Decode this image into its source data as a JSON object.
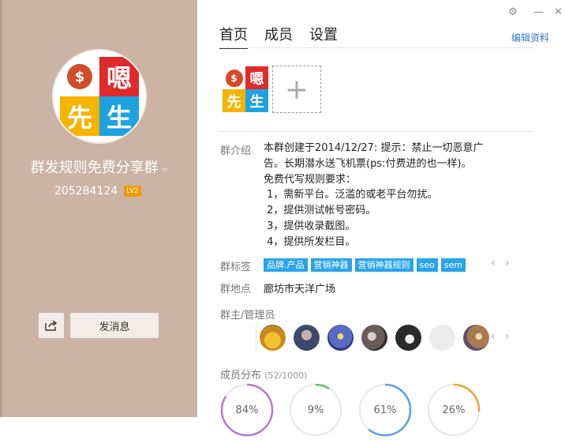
{
  "window": {
    "controls": {
      "pin": "⚙",
      "minimize": "—",
      "close": "✕"
    },
    "colors": {
      "sidebar": "#cbb3a6",
      "accent": "#2aa4e8",
      "link": "#2a7ac8",
      "level_badge": "#f39800"
    }
  },
  "logo": {
    "top_right": "嗯",
    "bottom_left": "先",
    "bottom_right": "生",
    "bag_symbol": "$"
  },
  "group": {
    "name": "群发规则免费分享群",
    "edit_icon": "edit-icon",
    "id": "205284124",
    "level": "LV2",
    "send_message_label": "发消息",
    "share_icon": "share-icon"
  },
  "tabs": [
    {
      "label": "首页",
      "active": true
    },
    {
      "label": "成员",
      "active": false
    },
    {
      "label": "设置",
      "active": false
    }
  ],
  "edit_profile_label": "编辑资料",
  "add_photo_symbol": "+",
  "intro": {
    "label": "群介绍",
    "lines": [
      "本群创建于2014/12/27:  提示：禁止一切恶意广",
      "告。长期潜水送飞机票(ps:付费进的也一样)。",
      "免费代写规则要求：",
      " 1，需新平台。泛滥的或老平台勿扰。",
      " 2，提供测试帐号密码。",
      " 3，提供收录截图。",
      " 4，提供所发栏目。"
    ]
  },
  "tags": {
    "label": "群标签",
    "items": [
      "品牌.产品",
      "营销神器",
      "营销神器规则",
      "seo",
      "sem"
    ],
    "prev": "‹",
    "next": "›"
  },
  "location": {
    "label": "群地点",
    "value": "廊坊市天洋广场"
  },
  "admins": {
    "label": "群主/管理员",
    "prev": "‹",
    "next": "›",
    "avatars": [
      {
        "name": "admin-avatar-1",
        "color": "#e0b040"
      },
      {
        "name": "admin-avatar-2",
        "color": "#4a5a78"
      },
      {
        "name": "admin-avatar-3",
        "color": "#5a6ac0"
      },
      {
        "name": "admin-avatar-4",
        "color": "#6a5a5a"
      },
      {
        "name": "admin-avatar-5",
        "color": "#2a2a2a"
      },
      {
        "name": "admin-avatar-6",
        "color": "#ececec"
      },
      {
        "name": "admin-avatar-7",
        "color": "#a87a50"
      }
    ]
  },
  "members": {
    "label": "成员分布",
    "count": "(52/1000)",
    "gauges": [
      {
        "pct": "84%",
        "value": 0.84,
        "color": "#b07ad0"
      },
      {
        "pct": "9%",
        "value": 0.09,
        "color": "#5ac07a"
      },
      {
        "pct": "61%",
        "value": 0.61,
        "color": "#5aa0e0"
      },
      {
        "pct": "26%",
        "value": 0.26,
        "color": "#f0a030"
      }
    ]
  }
}
